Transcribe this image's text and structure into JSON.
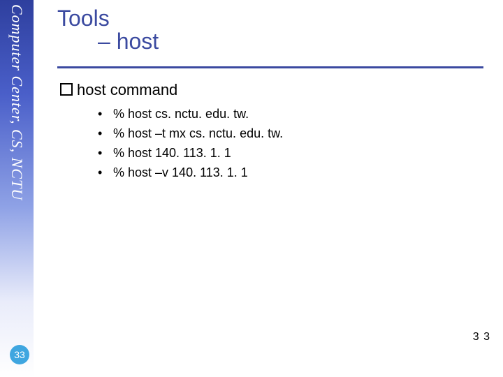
{
  "sidebar": {
    "label": "Computer Center, CS, NCTU"
  },
  "title": {
    "line1": "Tools",
    "line2": "– host"
  },
  "section": {
    "heading": "host command"
  },
  "bullets": {
    "b0": "% host cs. nctu. edu. tw.",
    "b1": "% host –t mx cs. nctu. edu. tw.",
    "b2": "% host 140. 113. 1. 1",
    "b3": "% host –v 140. 113. 1. 1"
  },
  "page": {
    "number_right": "3 3",
    "badge": "33"
  }
}
